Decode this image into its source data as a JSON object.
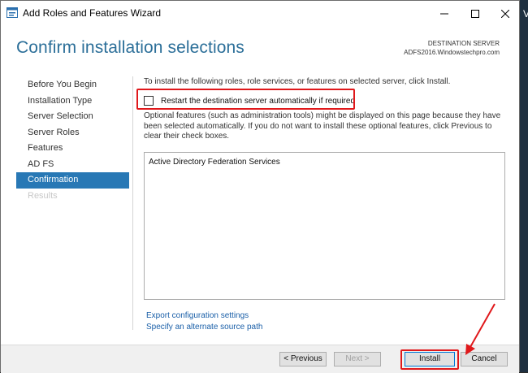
{
  "window": {
    "title": "Add Roles and Features Wizard",
    "background_letter": "V"
  },
  "header": {
    "page_title": "Confirm installation selections",
    "destination_label": "DESTINATION SERVER",
    "destination_server": "ADFS2016.Windowstechpro.com"
  },
  "nav": {
    "items": [
      {
        "label": "Before You Begin",
        "state": "normal"
      },
      {
        "label": "Installation Type",
        "state": "normal"
      },
      {
        "label": "Server Selection",
        "state": "normal"
      },
      {
        "label": "Server Roles",
        "state": "normal"
      },
      {
        "label": "Features",
        "state": "normal"
      },
      {
        "label": "AD FS",
        "state": "normal"
      },
      {
        "label": "Confirmation",
        "state": "active"
      },
      {
        "label": "Results",
        "state": "disabled"
      }
    ]
  },
  "content": {
    "intro": "To install the following roles, role services, or features on selected server, click Install.",
    "restart_checkbox_label": "Restart the destination server automatically if required",
    "restart_checked": false,
    "optional_note": "Optional features (such as administration tools) might be displayed on this page because they have been selected automatically. If you do not want to install these optional features, click Previous to clear their check boxes.",
    "features": [
      "Active Directory Federation Services"
    ],
    "export_link": "Export configuration settings",
    "alternate_source_link": "Specify an alternate source path"
  },
  "footer": {
    "previous_label": "< Previous",
    "next_label": "Next >",
    "install_label": "Install",
    "cancel_label": "Cancel"
  },
  "colors": {
    "accent_blue": "#2878b5",
    "title_blue": "#2c6f99",
    "annotation_red": "#e0181b"
  }
}
